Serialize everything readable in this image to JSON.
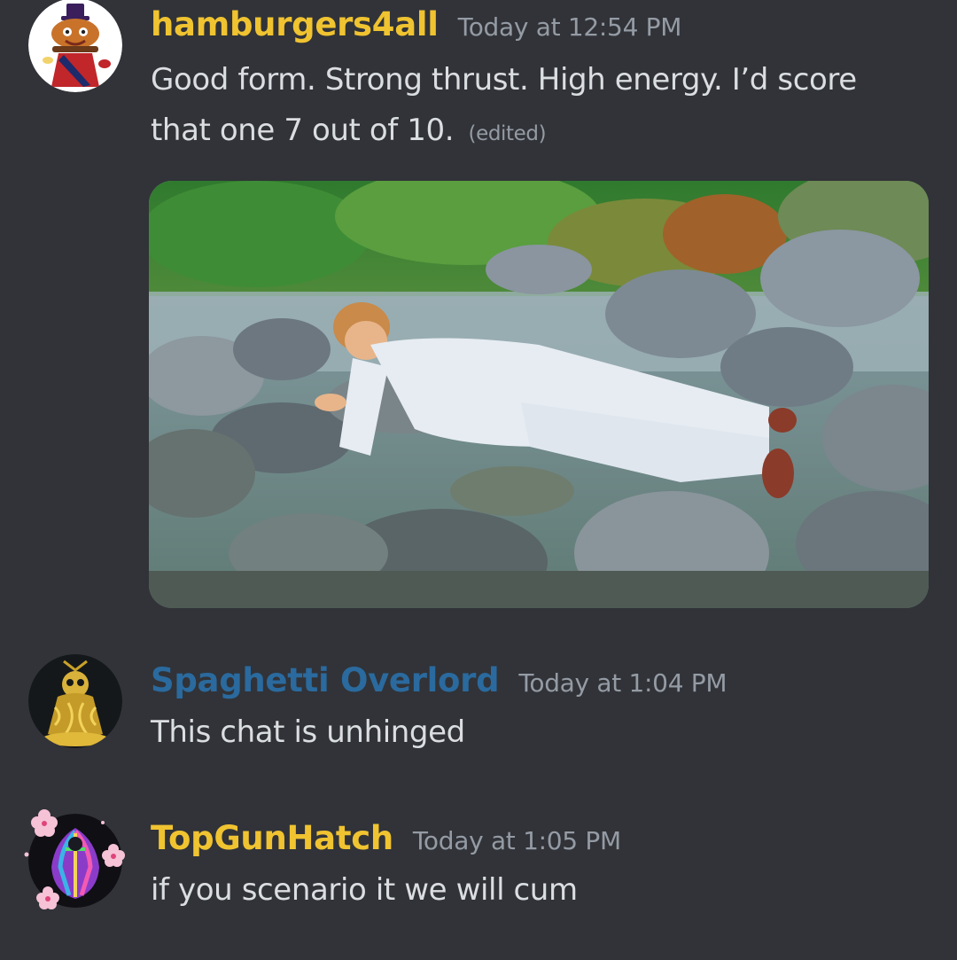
{
  "messages": [
    {
      "username": "hamburgers4all",
      "username_color": "#f0c330",
      "timestamp": "Today at 12:54 PM",
      "text": "Good form. Strong thrust. High energy. I’d score that one 7 out of 10.",
      "edited_label": "(edited)",
      "avatar_icon": "hamburger-mascot-avatar",
      "attachment": {
        "type": "image",
        "icon": "man-planking-on-river-rocks-image"
      }
    },
    {
      "username": "Spaghetti Overlord",
      "username_color": "#2a6a9e",
      "timestamp": "Today at 1:04 PM",
      "text": "This chat is unhinged",
      "avatar_icon": "golden-spaghetti-skull-avatar"
    },
    {
      "username": "TopGunHatch",
      "username_color": "#f0c330",
      "timestamp": "Today at 1:05 PM",
      "text": "if you scenario it we will cum",
      "avatar_icon": "rainbow-figure-avatar",
      "avatar_decoration_icon": "cherry-blossom-decoration"
    }
  ],
  "colors": {
    "background": "#313338",
    "text": "#dbdee1",
    "muted": "#949ba4"
  }
}
